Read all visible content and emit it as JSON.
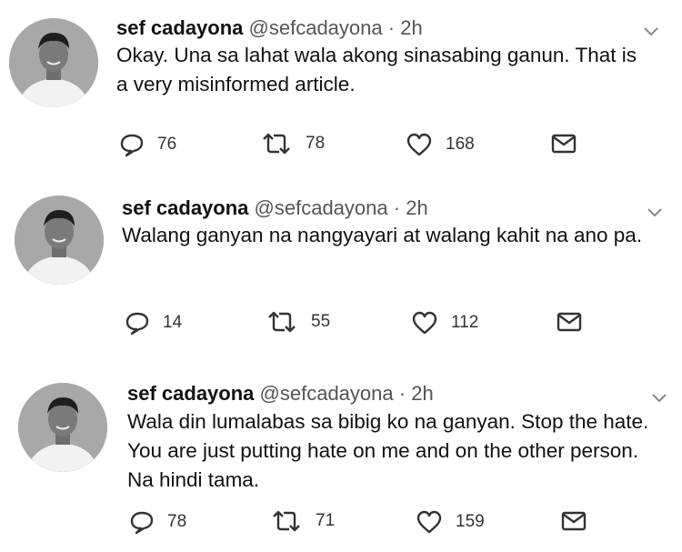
{
  "tweets": [
    {
      "name": "sef cadayona",
      "handle": "@sefcadayona",
      "dot": "·",
      "time": "2h",
      "lines": [
        "Okay. Una sa lahat wala akong sinasabing ganun. That is",
        "a very misinformed article."
      ],
      "replies": "76",
      "retweets": "78",
      "likes": "168"
    },
    {
      "name": "sef cadayona",
      "handle": "@sefcadayona",
      "dot": "·",
      "time": "2h",
      "lines": [
        "Walang ganyan na nangyayari at walang kahit na ano pa."
      ],
      "replies": "14",
      "retweets": "55",
      "likes": "112"
    },
    {
      "name": "sef cadayona",
      "handle": "@sefcadayona",
      "dot": "·",
      "time": "2h",
      "lines": [
        "Wala din lumalabas sa bibig ko na ganyan. Stop the hate.",
        "You are just putting hate on me and on the other person.",
        "Na hindi tama."
      ],
      "replies": "78",
      "retweets": "71",
      "likes": "159"
    }
  ],
  "icons": {
    "reply": "reply-icon",
    "retweet": "retweet-icon",
    "like": "heart-icon",
    "message": "envelope-icon",
    "more": "chevron-down-icon"
  },
  "colors": {
    "icon": "#333333",
    "name": "#111111",
    "meta": "#555555"
  }
}
